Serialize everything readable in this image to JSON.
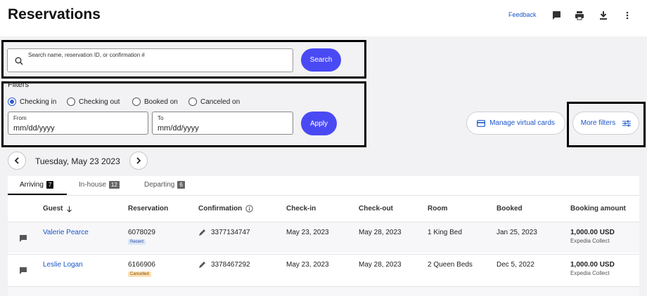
{
  "header": {
    "title": "Reservations",
    "feedback_label": "Feedback",
    "icons": [
      "message-icon",
      "print-icon",
      "download-icon",
      "more-vert-icon"
    ]
  },
  "search": {
    "placeholder": "Search name, reservation ID, or confirmation #",
    "button_label": "Search"
  },
  "filters": {
    "label": "Filters",
    "options": [
      {
        "label": "Checking in",
        "selected": true
      },
      {
        "label": "Checking out",
        "selected": false
      },
      {
        "label": "Booked on",
        "selected": false
      },
      {
        "label": "Canceled on",
        "selected": false
      }
    ],
    "from_label": "From",
    "from_value": "mm/dd/yyyy",
    "to_label": "To",
    "to_value": "mm/dd/yyyy",
    "apply_label": "Apply"
  },
  "actions": {
    "virtual_cards_label": "Manage virtual cards",
    "more_filters_label": "More filters"
  },
  "date_nav": {
    "date": "Tuesday, May 23 2023"
  },
  "tabs": [
    {
      "label": "Arriving",
      "count": "7",
      "active": true
    },
    {
      "label": "In-house",
      "count": "12",
      "active": false
    },
    {
      "label": "Departing",
      "count": "6",
      "active": false
    }
  ],
  "table": {
    "columns": [
      "Guest",
      "Reservation",
      "Confirmation",
      "Check-in",
      "Check-out",
      "Room",
      "Booked",
      "Booking amount"
    ],
    "rows": [
      {
        "guest": "Valerie Pearce",
        "reservation": "6078029",
        "tag": "Recent",
        "confirmation": "3377134747",
        "checkin": "May 23, 2023",
        "checkout": "May 28, 2023",
        "room": "1 King Bed",
        "booked": "Jan 25, 2023",
        "amount": "1,000.00 USD",
        "collect": "Expedia Collect"
      },
      {
        "guest": "Leslie Logan",
        "reservation": "6166906",
        "tag": "Cancelled",
        "confirmation": "3378467292",
        "checkin": "May 23, 2023",
        "checkout": "May 28, 2023",
        "room": "2 Queen Beds",
        "booked": "Dec 5, 2022",
        "amount": "1,000.00 USD",
        "collect": "Expedia Collect"
      }
    ]
  },
  "colors": {
    "primary": "#4a4af4",
    "link": "#1a55c9",
    "background": "#f2f2f4"
  }
}
